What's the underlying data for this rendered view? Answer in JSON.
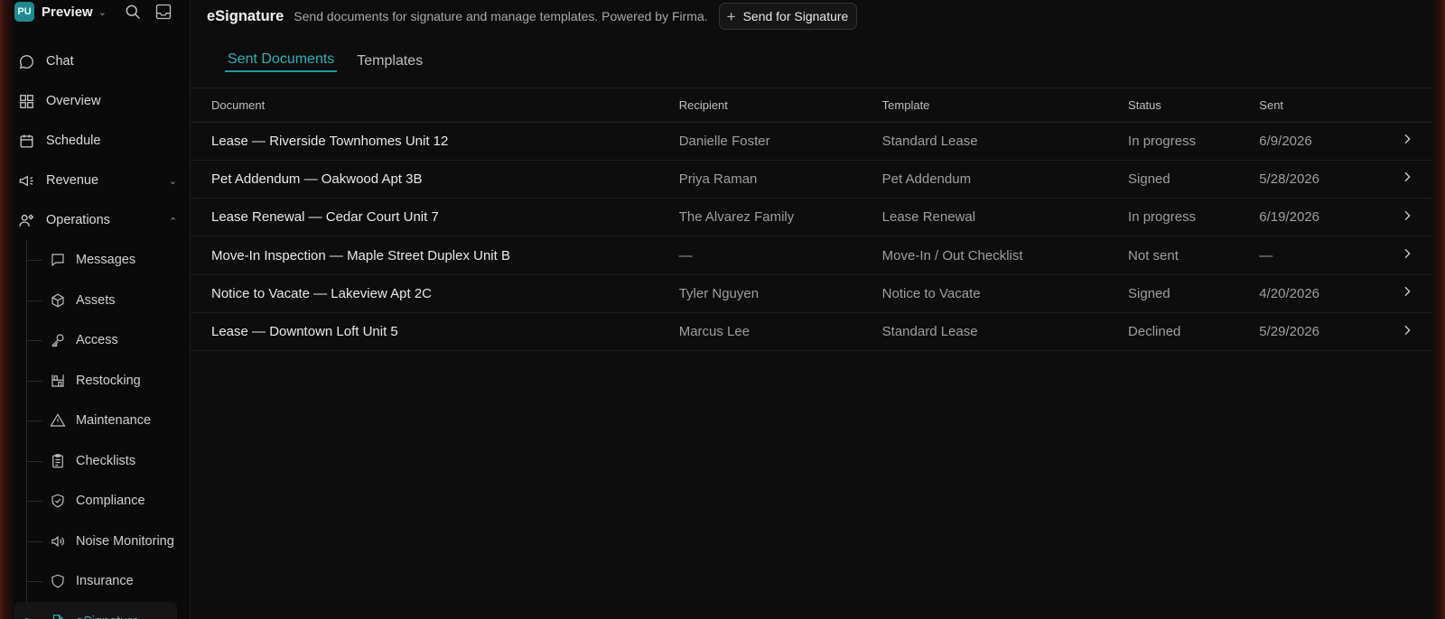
{
  "workspace": {
    "badge": "PU",
    "name": "Preview"
  },
  "sidebar": {
    "items": [
      {
        "label": "Chat",
        "icon": "chat-bubble-icon"
      },
      {
        "label": "Overview",
        "icon": "grid-icon"
      },
      {
        "label": "Schedule",
        "icon": "calendar-icon"
      },
      {
        "label": "Revenue",
        "icon": "megaphone-icon",
        "expandable": true,
        "expanded": false
      },
      {
        "label": "Operations",
        "icon": "people-gear-icon",
        "expandable": true,
        "expanded": true
      }
    ],
    "sub_items": [
      {
        "label": "Messages",
        "icon": "message-square-icon"
      },
      {
        "label": "Assets",
        "icon": "cube-icon"
      },
      {
        "label": "Access",
        "icon": "key-icon"
      },
      {
        "label": "Restocking",
        "icon": "shelves-icon"
      },
      {
        "label": "Maintenance",
        "icon": "warning-triangle-icon"
      },
      {
        "label": "Checklists",
        "icon": "clipboard-icon"
      },
      {
        "label": "Compliance",
        "icon": "shield-check-icon"
      },
      {
        "label": "Noise Monitoring",
        "icon": "speaker-icon"
      },
      {
        "label": "Insurance",
        "icon": "shield-icon"
      },
      {
        "label": "eSignature",
        "icon": "document-icon",
        "active": true
      }
    ]
  },
  "header": {
    "title": "eSignature",
    "subtitle": "Send documents for signature and manage templates. Powered by Firma.",
    "send_button": "Send for Signature"
  },
  "tabs": [
    {
      "label": "Sent Documents",
      "active": true
    },
    {
      "label": "Templates",
      "active": false
    }
  ],
  "table": {
    "columns": [
      "Document",
      "Recipient",
      "Template",
      "Status",
      "Sent"
    ],
    "rows": [
      {
        "document": "Lease — Riverside Townhomes Unit 12",
        "recipient": "Danielle Foster",
        "template": "Standard Lease",
        "status": "In progress",
        "sent": "6/9/2026"
      },
      {
        "document": "Pet Addendum — Oakwood Apt 3B",
        "recipient": "Priya Raman",
        "template": "Pet Addendum",
        "status": "Signed",
        "sent": "5/28/2026"
      },
      {
        "document": "Lease Renewal — Cedar Court Unit 7",
        "recipient": "The Alvarez Family",
        "template": "Lease Renewal",
        "status": "In progress",
        "sent": "6/19/2026"
      },
      {
        "document": "Move-In Inspection — Maple Street Duplex Unit B",
        "recipient": "—",
        "template": "Move-In / Out Checklist",
        "status": "Not sent",
        "sent": "—"
      },
      {
        "document": "Notice to Vacate — Lakeview Apt 2C",
        "recipient": "Tyler Nguyen",
        "template": "Notice to Vacate",
        "status": "Signed",
        "sent": "4/20/2026"
      },
      {
        "document": "Lease — Downtown Loft Unit 5",
        "recipient": "Marcus Lee",
        "template": "Standard Lease",
        "status": "Declined",
        "sent": "5/29/2026"
      }
    ]
  },
  "colors": {
    "accent": "#1f9aa2",
    "accent_text": "#2fb0b8",
    "background": "#0d0d0d"
  }
}
